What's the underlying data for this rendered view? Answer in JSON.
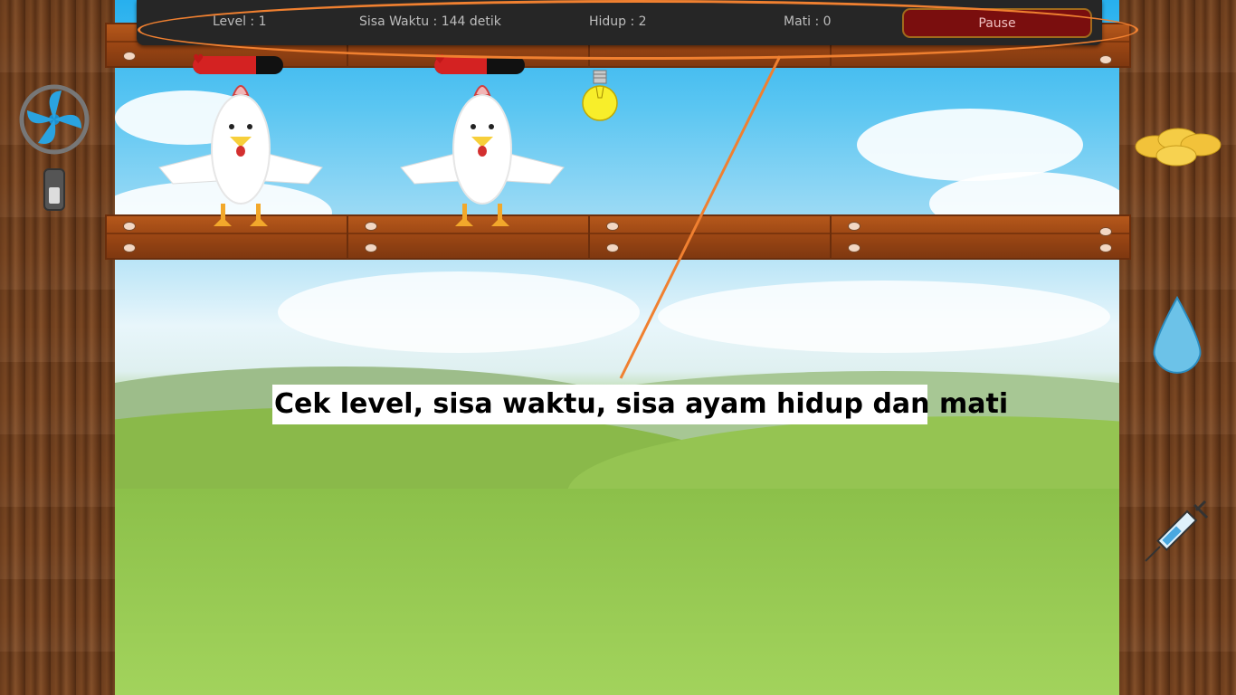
{
  "hud": {
    "level": "Level : 1",
    "time_left": "Sisa Waktu : 144 detik",
    "alive": "Hidup : 2",
    "dead": "Mati : 0",
    "pause_label": "Pause"
  },
  "chickens": [
    {
      "health": 0.7
    },
    {
      "health": 0.58
    }
  ],
  "left_tools": {
    "fan": "fan-icon",
    "fan_switch": "switch-icon"
  },
  "right_tools": {
    "feed": "corn-feed-icon",
    "water": "water-drop-icon",
    "medicine": "syringe-icon"
  },
  "ceiling_item": "light-bulb-icon",
  "annotation": {
    "text": "Cek level, sisa waktu, sisa ayam hidup dan mati",
    "color": "#f08030"
  }
}
